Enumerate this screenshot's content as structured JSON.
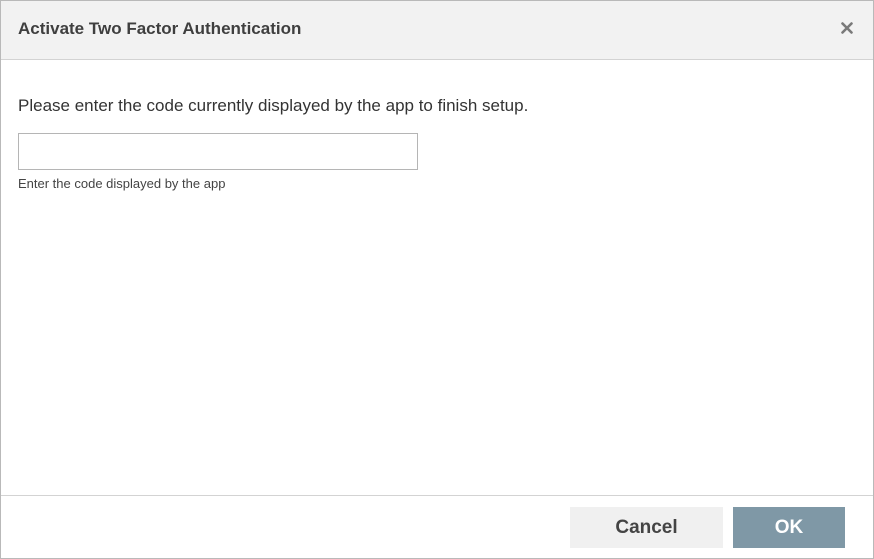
{
  "dialog": {
    "title": "Activate Two Factor Authentication",
    "close_icon": "close-icon",
    "instruction": "Please enter the code currently displayed by the app to finish setup.",
    "code_input": {
      "value": "",
      "placeholder": ""
    },
    "hint": "Enter the code displayed by the app",
    "buttons": {
      "cancel_label": "Cancel",
      "ok_label": "OK"
    }
  },
  "colors": {
    "header_bg": "#f2f2f2",
    "ok_button_bg": "#7f98a6",
    "cancel_button_bg": "#f0f0f0",
    "text": "#333333"
  }
}
